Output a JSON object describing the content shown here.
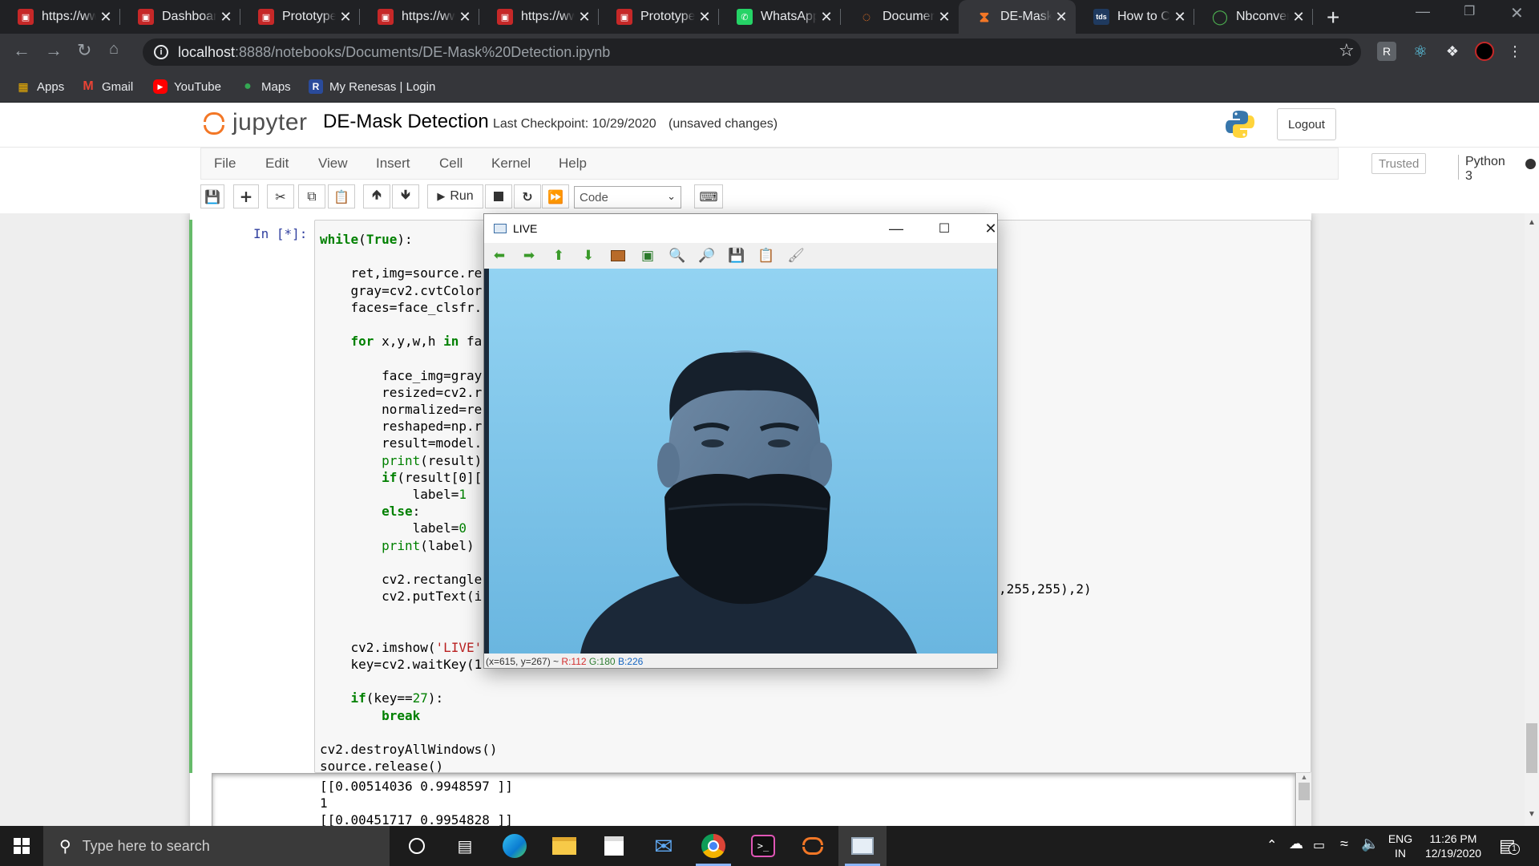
{
  "browser": {
    "tabs": [
      {
        "title": "https://ww",
        "favicon": "pdf-icon",
        "color": "#c62828"
      },
      {
        "title": "Dashboard",
        "favicon": "pdf-icon",
        "color": "#c62828"
      },
      {
        "title": "Prototype",
        "favicon": "pdf-icon",
        "color": "#c62828"
      },
      {
        "title": "https://ww",
        "favicon": "pdf-icon",
        "color": "#c62828"
      },
      {
        "title": "https://ww",
        "favicon": "pdf-icon",
        "color": "#c62828"
      },
      {
        "title": "Prototype",
        "favicon": "pdf-icon",
        "color": "#c62828"
      },
      {
        "title": "WhatsApp",
        "favicon": "whatsapp-icon",
        "color": "#25d366"
      },
      {
        "title": "Documents",
        "favicon": "jupyter-icon",
        "color": "#f37726"
      },
      {
        "title": "DE-Mask Detection",
        "favicon": "hourglass-icon",
        "color": "#f37726",
        "active": true
      },
      {
        "title": "How to Convert",
        "favicon": "tds-icon",
        "color": "#1f3a5f"
      },
      {
        "title": "Nbconvert",
        "favicon": "loading-icon",
        "color": "#4caf50"
      }
    ],
    "url_host": "localhost",
    "url_path": ":8888/notebooks/Documents/DE-Mask%20Detection.ipynb",
    "bookmarks": [
      {
        "label": "Apps",
        "icon": "apps-grid-icon"
      },
      {
        "label": "Gmail",
        "icon": "gmail-icon"
      },
      {
        "label": "YouTube",
        "icon": "youtube-icon"
      },
      {
        "label": "Maps",
        "icon": "maps-pin-icon"
      },
      {
        "label": "My Renesas | Login",
        "icon": "renesas-icon"
      }
    ]
  },
  "jupyter": {
    "logo_text": "jupyter",
    "notebook_name": "DE-Mask Detection",
    "checkpoint": "Last Checkpoint: 10/29/2020",
    "unsaved": "(unsaved changes)",
    "logout_label": "Logout",
    "menus": [
      "File",
      "Edit",
      "View",
      "Insert",
      "Cell",
      "Kernel",
      "Help"
    ],
    "trusted_label": "Trusted",
    "kernel_label": "Python 3",
    "run_label": "Run",
    "cell_type": "Code",
    "prompt": "In [*]:"
  },
  "code_lines": [
    "while(True):",
    "",
    "    ret,img=source.re",
    "    gray=cv2.cvtColor",
    "    faces=face_clsfr.",
    "",
    "    for x,y,w,h in fa",
    "",
    "        face_img=gray",
    "        resized=cv2.r",
    "        normalized=re",
    "        reshaped=np.r",
    "        result=model.",
    "        print(result)",
    "        if(result[0][",
    "            label=1",
    "        else:",
    "            label=0",
    "        print(label)",
    "",
    "        cv2.rectangle",
    "        cv2.putText(i",
    "",
    "",
    "    cv2.imshow('LIVE'",
    "    key=cv2.waitKey(1",
    "",
    "    if(key==27):",
    "        break",
    "",
    "cv2.destroyAllWindows()",
    "source.release()"
  ],
  "code_tail": ",255,255),2)",
  "output_lines": [
    "[[0.00514036 0.9948597 ]]",
    "1",
    "[[0.00451717 0.9954828 ]]"
  ],
  "live_window": {
    "title": "LIVE",
    "status_coords": "(x=615, y=267) ~",
    "status_r": "R:112",
    "status_g": "G:180",
    "status_b": "B:226"
  },
  "taskbar": {
    "search_placeholder": "Type here to search",
    "lang_top": "ENG",
    "lang_bottom": "IN",
    "time": "11:26 PM",
    "date": "12/19/2020",
    "notification_count": "1"
  }
}
